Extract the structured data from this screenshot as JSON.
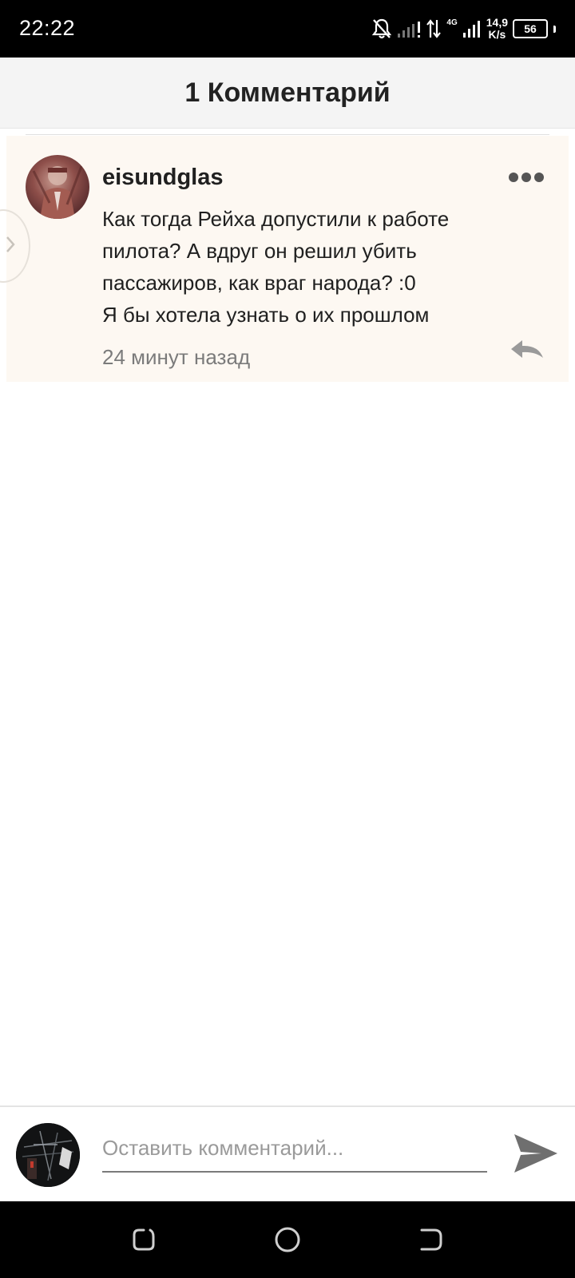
{
  "status_bar": {
    "time": "22:22",
    "network_generation": "4G",
    "speed_value": "14,9",
    "speed_unit": "K/s",
    "battery": "56"
  },
  "header": {
    "title": "1 Комментарий"
  },
  "comments": [
    {
      "author": "eisundglas",
      "text_lines": [
        "Как тогда Рейха допустили к работе",
        "пилота? А вдруг он решил убить",
        "пассажиров, как враг народа? :0",
        "Я бы хотела узнать о их прошлом"
      ],
      "time": "24 минут назад"
    }
  ],
  "composer": {
    "placeholder": "Оставить комментарий...",
    "value": ""
  },
  "icons": {
    "more": "more-icon",
    "reply": "reply-icon",
    "send": "send-icon",
    "nav_recent": "recent-apps-icon",
    "nav_home": "home-icon",
    "nav_back": "back-icon"
  },
  "colors": {
    "comment_background": "#fdf8f2",
    "header_background": "#f4f4f4",
    "status_bar": "#000000"
  }
}
